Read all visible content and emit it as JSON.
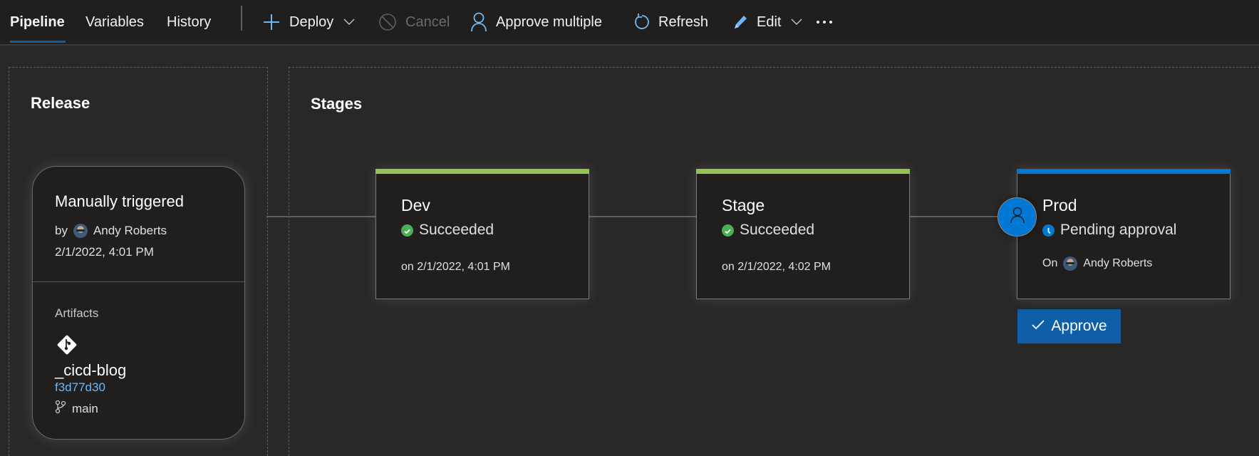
{
  "toolbar": {
    "tabs": [
      {
        "label": "Pipeline",
        "active": true
      },
      {
        "label": "Variables",
        "active": false
      },
      {
        "label": "History",
        "active": false
      }
    ],
    "actions": {
      "deploy": {
        "label": "Deploy",
        "icon": "plus-icon"
      },
      "cancel": {
        "label": "Cancel",
        "icon": "cancel-icon",
        "disabled": true
      },
      "approve_multiple": {
        "label": "Approve multiple",
        "icon": "person-icon"
      },
      "refresh": {
        "label": "Refresh",
        "icon": "refresh-icon"
      },
      "edit": {
        "label": "Edit",
        "icon": "pencil-icon"
      },
      "more": {
        "label": "···",
        "icon": "more-icon"
      }
    },
    "colors": {
      "icon_accent": "#6cb8f6",
      "active_underline": "#0b5ea8"
    }
  },
  "release": {
    "title": "Release",
    "trigger": "Manually triggered",
    "by_label": "by",
    "user": "Andy Roberts",
    "timestamp": "2/1/2022, 4:01 PM",
    "artifacts_label": "Artifacts",
    "artifact": {
      "name": "_cicd-blog",
      "commit": "f3d77d30",
      "branch": "main",
      "icon": "git-icon"
    }
  },
  "stages_panel": {
    "title": "Stages",
    "stages": [
      {
        "name": "Dev",
        "status": "Succeeded",
        "meta": "on 2/1/2022, 4:01 PM",
        "bar_color": "#92c353",
        "status_color": "#4caf50"
      },
      {
        "name": "Stage",
        "status": "Succeeded",
        "meta": "on 2/1/2022, 4:02 PM",
        "bar_color": "#92c353",
        "status_color": "#4caf50"
      },
      {
        "name": "Prod",
        "status": "Pending approval",
        "meta_prefix": "On",
        "meta_user": "Andy Roberts",
        "bar_color": "#0078d4",
        "status_color": "#0078d4"
      }
    ],
    "approve_button": "Approve"
  }
}
